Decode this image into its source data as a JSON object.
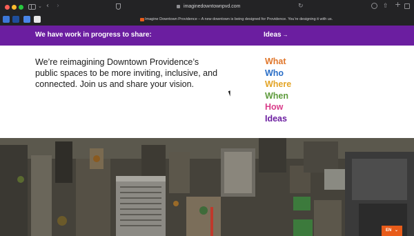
{
  "browser": {
    "url": "imaginedowntownpvd.com",
    "tab_title": "Imagine Downtown Providence – A new downtown is being designed for Providence. You’re designing it with us."
  },
  "banner": {
    "text": "We have work in progress to share:",
    "link_label": "Ideas",
    "link_arrow": "→"
  },
  "intro": {
    "text": "We’re reimagining Downtown Providence’s public spaces to be more inviting, inclusive, and connected. Join us and share your vision."
  },
  "nav_words": [
    {
      "label": "What",
      "color": "#e0762a"
    },
    {
      "label": "Who",
      "color": "#2a6ec7"
    },
    {
      "label": "Where",
      "color": "#e3a425"
    },
    {
      "label": "When",
      "color": "#5e9b3c"
    },
    {
      "label": "How",
      "color": "#d93c8a"
    },
    {
      "label": "Ideas",
      "color": "#6b1ea0"
    }
  ],
  "language_button": {
    "label": "EN",
    "icon": "chevron-down-icon"
  }
}
